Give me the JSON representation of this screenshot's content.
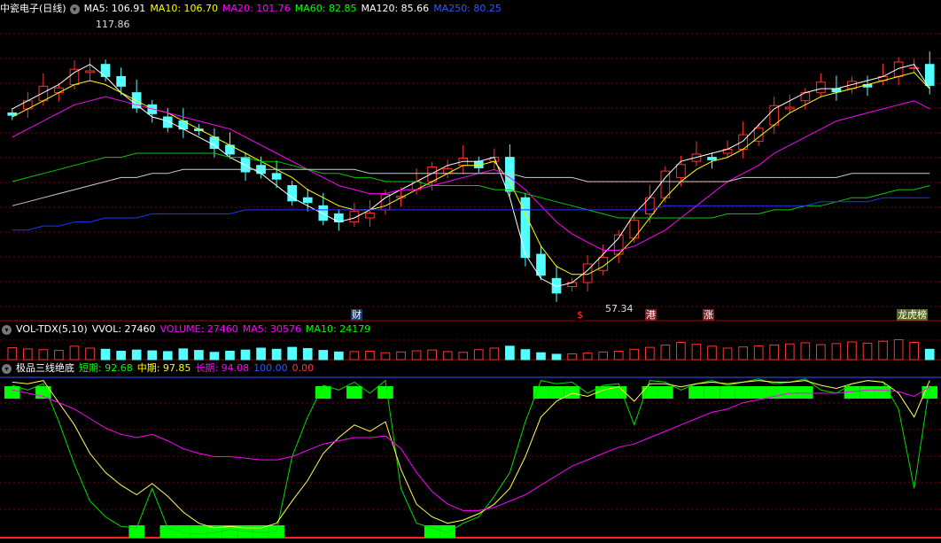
{
  "main": {
    "title": "中瓷电子(日线)",
    "legend": [
      {
        "label": "MA5: 106.91",
        "color": "#ffffff"
      },
      {
        "label": "MA10: 106.70",
        "color": "#ffff00"
      },
      {
        "label": "MA20: 101.76",
        "color": "#ff00ff"
      },
      {
        "label": "MA60: 82.85",
        "color": "#00ff00"
      },
      {
        "label": "MA120: 85.66",
        "color": "#ffffff"
      },
      {
        "label": "MA250: 80.25",
        "color": "#3355ff"
      }
    ],
    "high_label": "117.86",
    "low_label": "57.34",
    "tags": [
      {
        "text": "财",
        "color": "#ffffff",
        "bg": "#1a3a6a"
      },
      {
        "text": "$",
        "color": "#ff3333",
        "bg": "#000000"
      },
      {
        "text": "港",
        "color": "#ffffff",
        "bg": "#7a1f1f"
      },
      {
        "text": "涨",
        "color": "#ffffff",
        "bg": "#7a1f1f"
      },
      {
        "text": "龙虎榜",
        "color": "#ffffff",
        "bg": "#556622"
      }
    ]
  },
  "vol": {
    "title": "VOL-TDX(5,10)",
    "legend": [
      {
        "label": "VVOL: 27460",
        "color": "#ffffff"
      },
      {
        "label": "VOLUME: 27460",
        "color": "#ff00ff"
      },
      {
        "label": "MA5: 30576",
        "color": "#ff00ff"
      },
      {
        "label": "MA10: 24179",
        "color": "#00ff00"
      }
    ]
  },
  "ind": {
    "title": "极品三线绝底",
    "legend": [
      {
        "label": "短期: 92.68",
        "color": "#00ff00"
      },
      {
        "label": "中期: 97.85",
        "color": "#ffff00"
      },
      {
        "label": "长期: 94.08",
        "color": "#ff00ff"
      },
      {
        "label": "100.00",
        "color": "#3355ff"
      },
      {
        "label": "0.00",
        "color": "#ff3333"
      }
    ]
  },
  "colors": {
    "up": "#ff3333",
    "down": "#54ffff",
    "grid": "#7a0000"
  },
  "chart_data": [
    {
      "type": "candlestick",
      "title": "中瓷电子(日线)",
      "y_reference": {
        "high": 117.86,
        "low": 57.34
      },
      "series": [
        {
          "name": "MA5",
          "values": [
            102,
            104,
            106,
            108,
            111,
            113,
            110,
            106,
            103,
            100,
            99,
            97,
            95,
            93,
            90,
            88,
            86,
            83,
            80,
            78,
            76,
            74,
            75,
            77,
            80,
            82,
            84,
            86,
            88,
            89,
            89,
            90,
            80,
            66,
            60,
            58,
            59,
            62,
            66,
            70,
            76,
            80,
            85,
            89,
            90,
            91,
            92,
            94,
            98,
            102,
            104,
            106,
            107,
            107,
            108,
            109,
            110,
            112,
            113,
            107
          ]
        },
        {
          "name": "MA10",
          "values": [
            100,
            102,
            104,
            106,
            108,
            109,
            108,
            106,
            104,
            102,
            101,
            99,
            97,
            95,
            93,
            91,
            89,
            87,
            85,
            82,
            80,
            78,
            77,
            77,
            78,
            80,
            82,
            84,
            86,
            88,
            88,
            89,
            84,
            76,
            68,
            63,
            61,
            61,
            63,
            66,
            70,
            75,
            80,
            84,
            87,
            89,
            90,
            92,
            95,
            98,
            101,
            103,
            105,
            106,
            107,
            108,
            109,
            110,
            111,
            107
          ]
        },
        {
          "name": "MA20",
          "values": [
            95,
            97,
            99,
            101,
            103,
            104,
            105,
            104,
            103,
            102,
            101,
            100,
            99,
            98,
            97,
            95,
            93,
            91,
            89,
            87,
            85,
            83,
            82,
            81,
            81,
            82,
            82,
            83,
            84,
            85,
            86,
            87,
            85,
            82,
            78,
            74,
            71,
            69,
            67,
            67,
            68,
            70,
            72,
            75,
            78,
            81,
            84,
            86,
            88,
            91,
            93,
            95,
            97,
            99,
            100,
            101,
            102,
            103,
            104,
            102
          ]
        },
        {
          "name": "MA60",
          "values": [
            84,
            85,
            86,
            87,
            88,
            89,
            90,
            90,
            91,
            91,
            91,
            91,
            91,
            91,
            90,
            90,
            89,
            89,
            88,
            87,
            86,
            86,
            85,
            85,
            84,
            84,
            84,
            83,
            83,
            83,
            83,
            82,
            82,
            81,
            80,
            79,
            78,
            77,
            76,
            75,
            75,
            75,
            75,
            75,
            75,
            75,
            76,
            76,
            76,
            77,
            77,
            78,
            78,
            79,
            80,
            80,
            81,
            82,
            82,
            83
          ]
        },
        {
          "name": "MA120",
          "values": [
            78,
            79,
            80,
            81,
            82,
            83,
            84,
            85,
            85,
            86,
            86,
            87,
            87,
            87,
            87,
            87,
            87,
            87,
            87,
            87,
            87,
            87,
            87,
            86,
            86,
            86,
            86,
            86,
            86,
            86,
            86,
            86,
            86,
            85,
            85,
            85,
            85,
            84,
            84,
            84,
            84,
            84,
            84,
            84,
            84,
            84,
            84,
            85,
            85,
            85,
            85,
            85,
            85,
            85,
            86,
            86,
            86,
            86,
            86,
            86
          ]
        },
        {
          "name": "MA250",
          "values": [
            72,
            72,
            73,
            73,
            74,
            74,
            75,
            75,
            75,
            76,
            76,
            76,
            76,
            76,
            76,
            77,
            77,
            77,
            77,
            77,
            77,
            77,
            77,
            77,
            77,
            77,
            77,
            77,
            77,
            77,
            77,
            77,
            77,
            77,
            77,
            77,
            77,
            77,
            77,
            77,
            77,
            77,
            78,
            78,
            78,
            78,
            78,
            78,
            78,
            78,
            78,
            78,
            79,
            79,
            79,
            79,
            80,
            80,
            80,
            80
          ]
        }
      ]
    },
    {
      "type": "bar",
      "title": "VOL-TDX(5,10)",
      "values": [
        31,
        28,
        26,
        24,
        35,
        30,
        27,
        22,
        25,
        23,
        21,
        28,
        24,
        19,
        22,
        25,
        30,
        27,
        32,
        29,
        24,
        20,
        21,
        22,
        18,
        20,
        23,
        25,
        21,
        19,
        26,
        30,
        35,
        26,
        18,
        14,
        15,
        17,
        20,
        22,
        27,
        32,
        38,
        45,
        40,
        35,
        30,
        33,
        36,
        38,
        41,
        44,
        39,
        42,
        46,
        43,
        48,
        52,
        45,
        27
      ]
    },
    {
      "type": "line",
      "title": "极品三线绝底",
      "ylim": [
        0,
        100
      ],
      "series": [
        {
          "name": "短期",
          "values": [
            95,
            92,
            96,
            72,
            45,
            22,
            12,
            6,
            5,
            30,
            5,
            2,
            1,
            2,
            4,
            3,
            2,
            3,
            50,
            75,
            95,
            92,
            97,
            90,
            98,
            30,
            8,
            5,
            2,
            8,
            12,
            25,
            40,
            72,
            98,
            96,
            97,
            90,
            95,
            96,
            70,
            98,
            97,
            92,
            96,
            98,
            95,
            97,
            99,
            96,
            97,
            99,
            92,
            90,
            96,
            98,
            97,
            80,
            30,
            95
          ]
        },
        {
          "name": "中期",
          "values": [
            97,
            96,
            98,
            84,
            70,
            52,
            40,
            32,
            26,
            33,
            25,
            15,
            8,
            5,
            6,
            5,
            5,
            8,
            22,
            35,
            52,
            62,
            70,
            66,
            72,
            42,
            20,
            12,
            8,
            10,
            14,
            20,
            30,
            50,
            75,
            85,
            90,
            88,
            92,
            94,
            85,
            96,
            96,
            94,
            96,
            97,
            96,
            97,
            98,
            97,
            97,
            98,
            95,
            93,
            96,
            98,
            97,
            90,
            75,
            98
          ]
        },
        {
          "name": "长期",
          "values": [
            92,
            90,
            88,
            84,
            80,
            74,
            68,
            64,
            62,
            64,
            60,
            55,
            52,
            50,
            50,
            49,
            48,
            48,
            50,
            54,
            58,
            60,
            62,
            62,
            63,
            55,
            40,
            28,
            20,
            16,
            16,
            18,
            22,
            26,
            32,
            38,
            44,
            48,
            52,
            56,
            58,
            62,
            66,
            70,
            74,
            78,
            80,
            84,
            86,
            88,
            90,
            90,
            90,
            90,
            91,
            92,
            92,
            91,
            88,
            94
          ]
        }
      ]
    }
  ]
}
